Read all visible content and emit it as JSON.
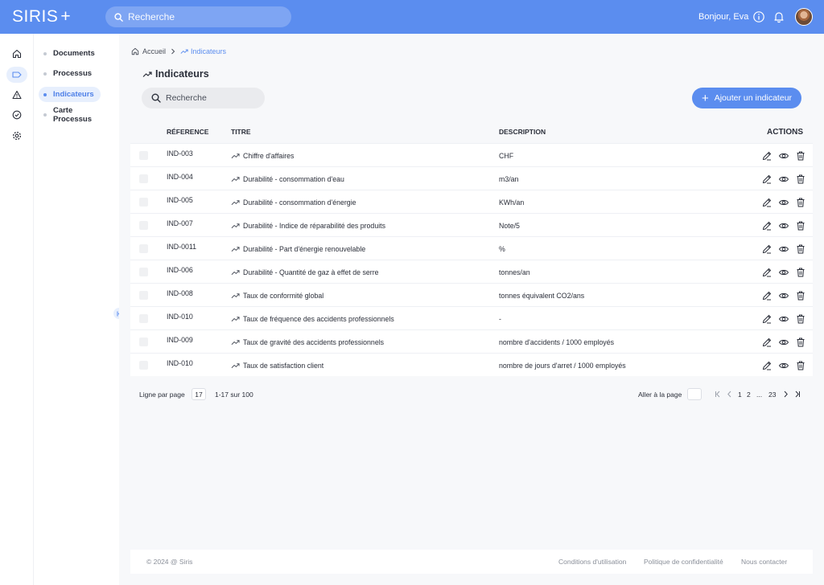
{
  "app": {
    "logo_text": "SIRIS",
    "logo_plus": "+",
    "search_placeholder": "Recherche",
    "greeting": "Bonjour, Eva"
  },
  "subnav": [
    {
      "label": "Documents",
      "active": false
    },
    {
      "label": "Processus",
      "active": false
    },
    {
      "label": "Indicateurs",
      "active": true
    },
    {
      "label": "Carte Processus",
      "active": false
    }
  ],
  "breadcrumb": {
    "home": "Accueil",
    "current": "Indicateurs"
  },
  "page": {
    "title": "Indicateurs",
    "search_placeholder": "Recherche",
    "add_button": "Ajouter un indicateur"
  },
  "table": {
    "headers": {
      "reference": "RÉFERENCE",
      "titre": "TITRE",
      "description": "DESCRIPTION",
      "actions": "ACTIONS"
    },
    "rows": [
      {
        "ref": "IND-003",
        "title": "Chiffre d'affaires",
        "desc": "CHF"
      },
      {
        "ref": "IND-004",
        "title": "Durabilité - consommation d'eau",
        "desc": "m3/an"
      },
      {
        "ref": "IND-005",
        "title": "Durabilité - consommation d'énergie",
        "desc": "KWh/an"
      },
      {
        "ref": "IND-007",
        "title": "Durabilité - Indice de réparabilité des produits",
        "desc": "Note/5"
      },
      {
        "ref": "IND-0011",
        "title": "Durabilité - Part d'énergie renouvelable",
        "desc": "%"
      },
      {
        "ref": "IND-006",
        "title": "Durabilité - Quantité de gaz à effet de serre",
        "desc": "tonnes/an"
      },
      {
        "ref": "IND-008",
        "title": "Taux de conformité global",
        "desc": "tonnes équivalent CO2/ans"
      },
      {
        "ref": "IND-010",
        "title": "Taux de fréquence des accidents professionnels",
        "desc": "-"
      },
      {
        "ref": "IND-009",
        "title": "Taux de gravité des accidents professionnels",
        "desc": "nombre d'accidents / 1000 employés"
      },
      {
        "ref": "IND-010",
        "title": "Taux de satisfaction client",
        "desc": "nombre de jours d'arret / 1000 employés"
      }
    ]
  },
  "pagination": {
    "rows_label": "Ligne par page",
    "rows_value": "17",
    "range": "1-17 sur 100",
    "goto_label": "Aller à la page",
    "pages": [
      "1",
      "2",
      "...",
      "23"
    ]
  },
  "footer": {
    "copyright": "© 2024 @ Siris",
    "terms": "Conditions d'utilisation",
    "privacy": "Politique de confidentialité",
    "contact": "Nous contacter"
  },
  "colors": {
    "primary": "#5b8def",
    "active_bg": "#e7effd"
  }
}
